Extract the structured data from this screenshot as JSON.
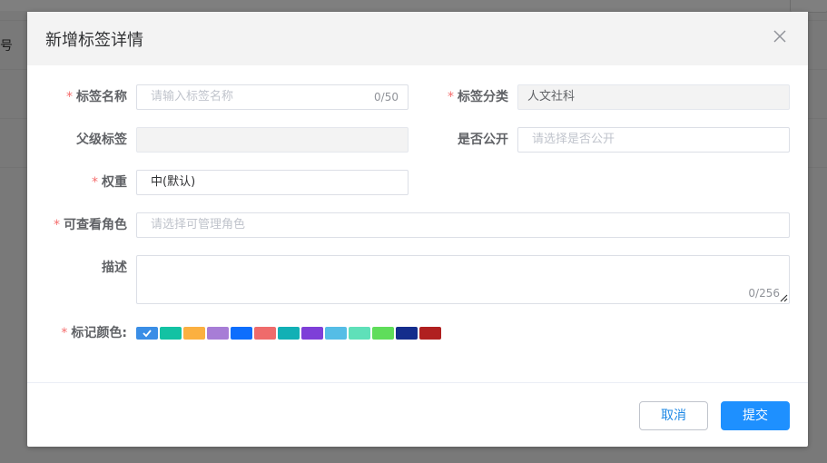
{
  "background": {
    "partial_text": "号"
  },
  "dialog": {
    "title": "新增标签详情"
  },
  "form": {
    "tag_name": {
      "label": "标签名称",
      "required": "*",
      "placeholder": "请输入标签名称",
      "counter": "0/50"
    },
    "tag_category": {
      "label": "标签分类",
      "required": "*",
      "value": "人文社科"
    },
    "parent_tag": {
      "label": "父级标签",
      "value": ""
    },
    "is_public": {
      "label": "是否公开",
      "placeholder": "请选择是否公开"
    },
    "weight": {
      "label": "权重",
      "required": "*",
      "value": "中(默认)"
    },
    "viewer_roles": {
      "label": "可查看角色",
      "required": "*",
      "placeholder": "请选择可管理角色"
    },
    "description": {
      "label": "描述",
      "counter": "0/256"
    },
    "mark_color": {
      "label": "标记颜色:",
      "required": "*",
      "selected_index": 0,
      "colors": [
        "#3a8ee6",
        "#13c2a3",
        "#fbb040",
        "#a77dd6",
        "#0d6efd",
        "#ef6b6b",
        "#12b0b5",
        "#7e3fd8",
        "#55bde6",
        "#5fe0b9",
        "#5fdd5a",
        "#142d8c",
        "#b02020"
      ]
    }
  },
  "footer": {
    "cancel_label": "取消",
    "submit_label": "提交"
  }
}
